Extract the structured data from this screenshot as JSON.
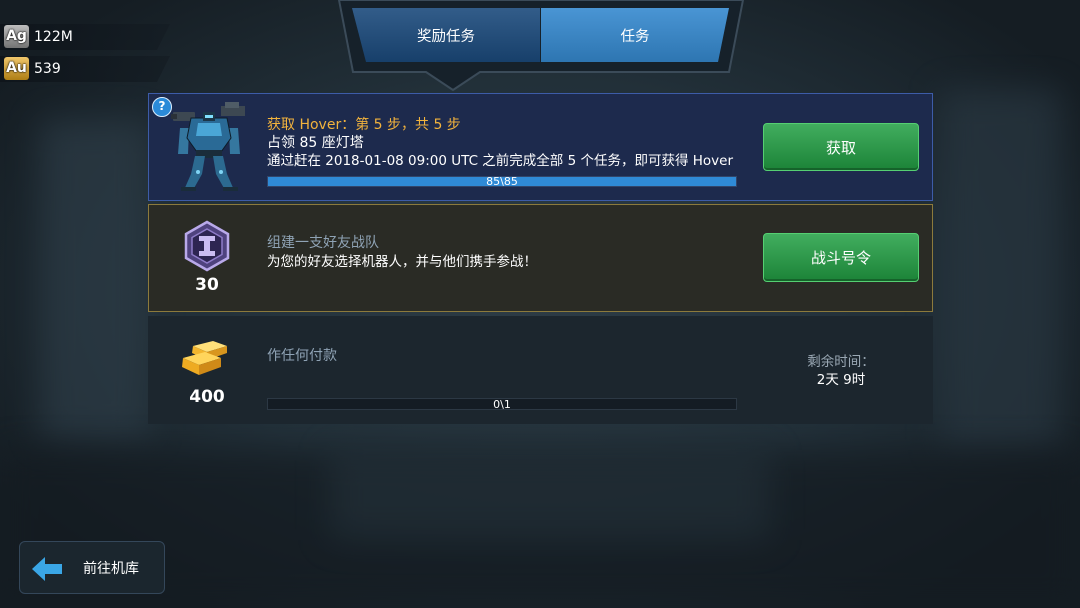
{
  "currencies": [
    {
      "symbol": "Ag",
      "amount": "122M",
      "icon": "silver-badge-icon",
      "badge_color": "#9a9a9a"
    },
    {
      "symbol": "Au",
      "amount": "539",
      "icon": "gold-badge-icon",
      "badge_color": "#e8a81c"
    }
  ],
  "tabs": [
    {
      "label": "奖励任务",
      "selected": true,
      "color": "#1b4a7c"
    },
    {
      "label": "任务",
      "selected": false,
      "color": "#3589cf"
    }
  ],
  "missions": [
    {
      "icon": "hover-robot-icon",
      "help_icon": {
        "name": "help-icon",
        "glyph": "?"
      },
      "title": "获取 Hover：第 5 步，共 5 步",
      "title_color": "#f2b33d",
      "subtitle": "占领 85 座灯塔",
      "description": "通过赶在 2018-01-08 09:00 UTC 之前完成全部 5 个任务，即可获得 Hover",
      "progress": {
        "current": 85,
        "total": 85,
        "label": "85\\85"
      },
      "button_label": "获取",
      "border_color": "#3d5ca8",
      "background_color": "#1d2a4d"
    },
    {
      "icon": "hexagon-badge-icon",
      "reward": "30",
      "title": "组建一支好友战队",
      "title_color": "#8fa3b5",
      "description": "为您的好友选择机器人，并与他们携手参战！",
      "button_label": "战斗号令",
      "border_color": "#8c7a3c",
      "background_color": "#2a2b25"
    },
    {
      "icon": "gold-bars-icon",
      "reward": "400",
      "title": "作任何付款",
      "title_color": "#8fa3b5",
      "progress": {
        "current": 0,
        "total": 1,
        "label": "0\\1"
      },
      "time_left": {
        "label": "剩余时间：",
        "value": "2天 9时"
      },
      "background_color": "#1c262e"
    }
  ],
  "back_button": {
    "label": "前往机库",
    "icon": "arrow-left-icon",
    "icon_color": "#3aa6e6"
  },
  "colors": {
    "button_green": "#22a044",
    "progress_fill": "#2f8ad6",
    "background": "#1f2b33"
  }
}
